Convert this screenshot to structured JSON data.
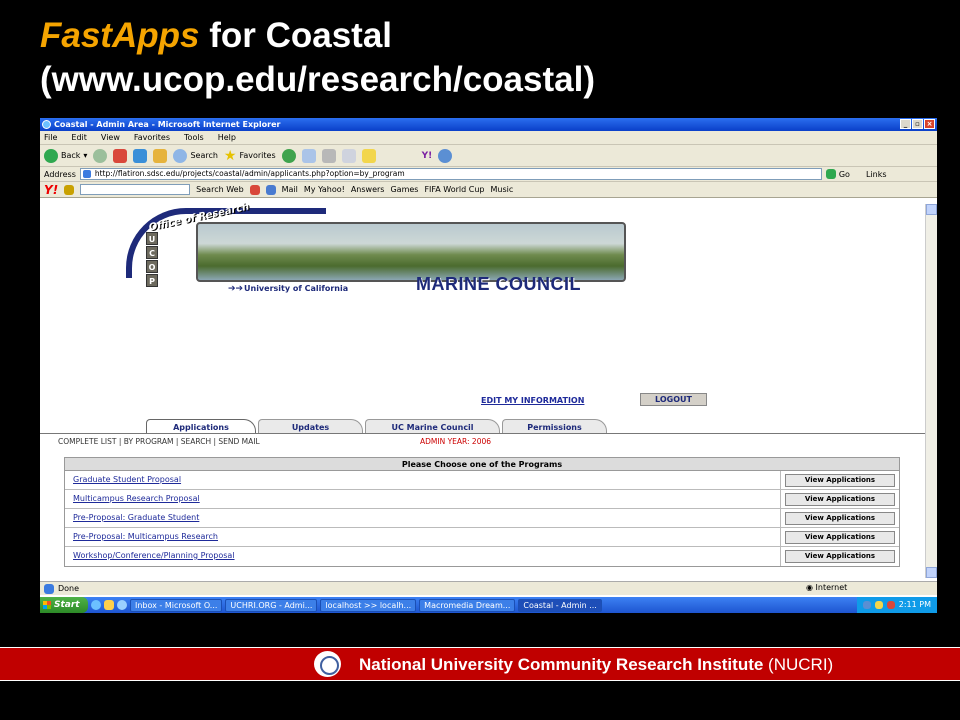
{
  "slide": {
    "title_highlight": "FastApps",
    "title_rest": " for Coastal",
    "title_line2": "(www.ucop.edu/research/coastal)"
  },
  "window": {
    "title": "Coastal - Admin Area - Microsoft Internet Explorer",
    "menu": [
      "File",
      "Edit",
      "View",
      "Favorites",
      "Tools",
      "Help"
    ],
    "toolbar": {
      "back": "Back",
      "search": "Search",
      "favorites": "Favorites"
    },
    "address_label": "Address",
    "address_url": "http://flatiron.sdsc.edu/projects/coastal/admin/applicants.php?option=by_program",
    "go": "Go",
    "links": "Links",
    "yahoo_bar": {
      "search_web": "Search Web",
      "mail": "Mail",
      "my_yahoo": "My Yahoo!",
      "answers": "Answers",
      "games": "Games",
      "fifa": "FIFA World Cup",
      "music": "Music"
    }
  },
  "page": {
    "banner": {
      "office": "Office of Research",
      "ucop": [
        "U",
        "C",
        "O",
        "P"
      ],
      "university": "University of California",
      "council": "MARINE COUNCIL"
    },
    "edit_info": "EDIT MY INFORMATION",
    "logout": "LOGOUT",
    "tabs": [
      "Applications",
      "Updates",
      "UC Marine Council",
      "Permissions"
    ],
    "subnav": "COMPLETE LIST | BY PROGRAM | SEARCH | SEND MAIL",
    "admin_year": "ADMIN YEAR: 2006",
    "table_heading": "Please Choose one of the Programs",
    "programs": [
      "Graduate Student Proposal",
      "Multicampus Research Proposal",
      "Pre-Proposal: Graduate Student",
      "Pre-Proposal: Multicampus Research",
      "Workshop/Conference/Planning Proposal"
    ],
    "view_button": "View Applications"
  },
  "status": {
    "left": "Done",
    "zone": "Internet"
  },
  "taskbar": {
    "start": "Start",
    "tasks": [
      "Inbox - Microsoft O...",
      "UCHRI.ORG - Admi...",
      "localhost >> localh...",
      "Macromedia Dream...",
      "Coastal - Admin ..."
    ],
    "clock": "2:11 PM"
  },
  "footer": {
    "bold": "National University Community Research Institute",
    "light": " (NUCRI)"
  },
  "colors": {
    "highlight": "#f5a400",
    "footer": "#c00000",
    "link": "#1e2a9a"
  }
}
